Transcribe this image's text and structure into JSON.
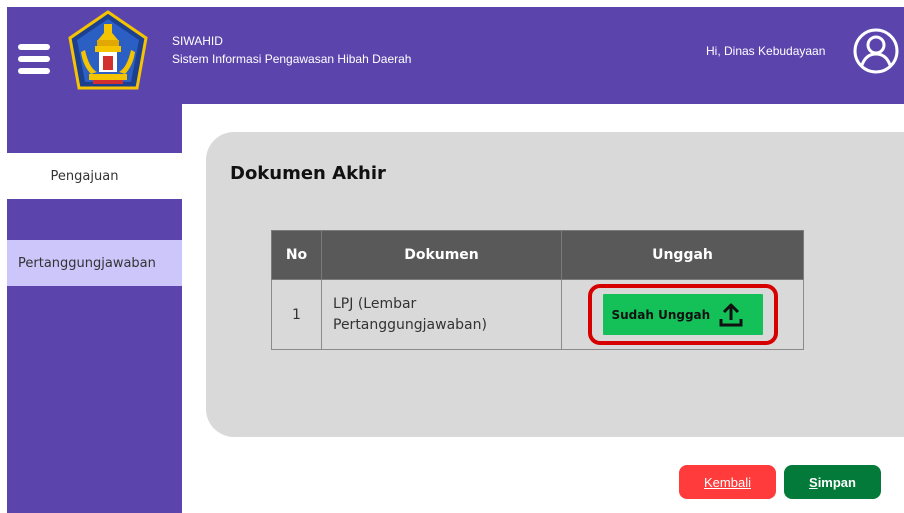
{
  "header": {
    "app_name": "SIWAHID",
    "app_subtitle": "Sistem Informasi Pengawasan Hibah Daerah",
    "greeting": "Hi, Dinas Kebudayaan"
  },
  "icons": {
    "menu": "hamburger-menu-icon",
    "logo": "provincial-emblem-logo",
    "user": "user-avatar-icon",
    "upload": "upload-arrow-icon"
  },
  "sidebar": {
    "items": [
      {
        "label": "Pengajuan"
      },
      {
        "label": "Pertanggungjawaban"
      }
    ]
  },
  "main": {
    "title": "Dokumen Akhir",
    "table": {
      "headers": [
        "No",
        "Dokumen",
        "Unggah"
      ],
      "rows": [
        {
          "no": "1",
          "dokumen_line1": "LPJ (Lembar",
          "dokumen_line2": "Pertanggungjawaban)",
          "action": "Sudah Unggah"
        }
      ]
    }
  },
  "actions": {
    "kembali": "Kembali",
    "simpan_first": "S",
    "simpan_rest": "impan"
  },
  "colors": {
    "brand": "#5b45ad",
    "sidebar_active": "#ccc6fb",
    "upload_green": "#14c159",
    "highlight_red": "#d60000",
    "kembali_red": "#ff3b3b",
    "simpan_green": "#047a3a"
  }
}
